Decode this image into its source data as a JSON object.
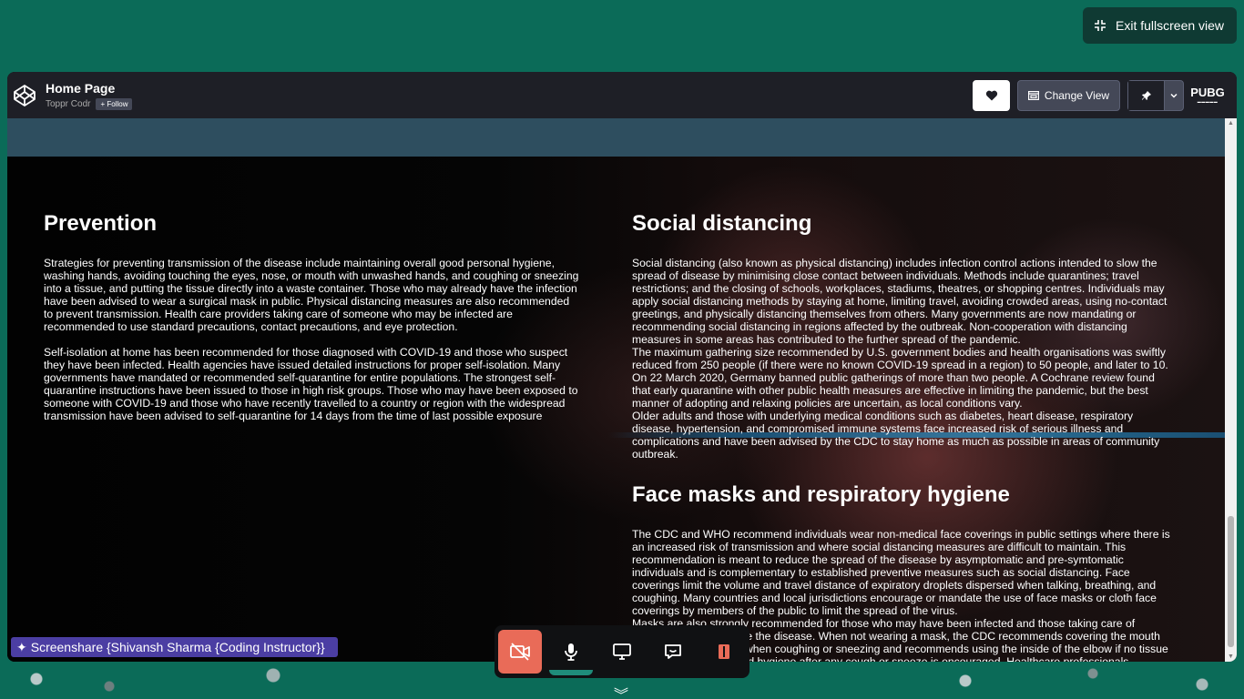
{
  "fullscreen": {
    "exit_label": "Exit fullscreen view"
  },
  "codepen": {
    "title": "Home Page",
    "author": "Toppr Codr",
    "follow_label": "+ Follow",
    "change_view_label": "Change View",
    "badge_logo_text": "PUBG"
  },
  "sections": {
    "prevention": {
      "heading": "Prevention",
      "p1": "Strategies for preventing transmission of the disease include maintaining overall good personal hygiene, washing hands, avoiding touching the eyes, nose, or mouth with unwashed hands, and coughing or sneezing into a tissue, and putting the tissue directly into a waste container. Those who may already have the infection have been advised to wear a surgical mask in public. Physical distancing measures are also recommended to prevent transmission. Health care providers taking care of someone who may be infected are recommended to use standard precautions, contact precautions, and eye protection.",
      "p2": "Self-isolation at home has been recommended for those diagnosed with COVID-19 and those who suspect they have been infected. Health agencies have issued detailed instructions for proper self-isolation. Many governments have mandated or recommended self-quarantine for entire populations. The strongest self-quarantine instructions have been issued to those in high risk groups. Those who may have been exposed to someone with COVID-19 and those who have recently travelled to a country or region with the widespread transmission have been advised to self-quarantine for 14 days from the time of last possible exposure"
    },
    "social": {
      "heading": "Social distancing",
      "p1": "Social distancing (also known as physical distancing) includes infection control actions intended to slow the spread of disease by minimising close contact between individuals. Methods include quarantines; travel restrictions; and the closing of schools, workplaces, stadiums, theatres, or shopping centres. Individuals may apply social distancing methods by staying at home, limiting travel, avoiding crowded areas, using no-contact greetings, and physically distancing themselves from others. Many governments are now mandating or recommending social distancing in regions affected by the outbreak. Non-cooperation with distancing measures in some areas has contributed to the further spread of the pandemic.",
      "p2": "The maximum gathering size recommended by U.S. government bodies and health organisations was swiftly reduced from 250 people (if there were no known COVID-19 spread in a region) to 50 people, and later to 10. On 22 March 2020, Germany banned public gatherings of more than two people. A Cochrane review found that early quarantine with other public health measures are effective in limiting the pandemic, but the best manner of adopting and relaxing policies are uncertain, as local conditions vary.",
      "p3": "Older adults and those with underlying medical conditions such as diabetes, heart disease, respiratory disease, hypertension, and compromised immune systems face increased risk of serious illness and complications and have been advised by the CDC to stay home as much as possible in areas of community outbreak."
    },
    "masks": {
      "heading": "Face masks and respiratory hygiene",
      "p1": "The CDC and WHO recommend individuals wear non-medical face coverings in public settings where there is an increased risk of transmission and where social distancing measures are difficult to maintain. This recommendation is meant to reduce the spread of the disease by asymptomatic and pre-symtomatic individuals and is complementary to established preventive measures such as social distancing. Face coverings limit the volume and travel distance of expiratory droplets dispersed when talking, breathing, and coughing. Many countries and local jurisdictions encourage or mandate the use of face masks or cloth face coverings by members of the public to limit the spread of the virus.",
      "p2": "Masks are also strongly recommended for those who may have been infected and those taking care of someone who may have the disease. When not wearing a mask, the CDC recommends covering the mouth and nose with a tissue when coughing or sneezing and recommends using the inside of the elbow if no tissue is available. Proper hand hygiene after any cough or sneeze is encouraged. Healthcare professionals interacting directly with COVID-19 patients are advised to use respirators at least as protective as NIOSH-certified N95 or equivalent, in addition to other personal protective equipment."
    }
  },
  "screenshare": {
    "label": "Screenshare {Shivansh Sharma {Coding Instructor}}"
  },
  "icons": [
    "exit-fullscreen-icon",
    "codepen-logo-icon",
    "heart-icon",
    "change-view-icon",
    "pin-icon",
    "chevron-down-icon",
    "camera-off-icon",
    "mic-icon",
    "screen-icon",
    "chat-icon",
    "leave-icon"
  ],
  "colors": {
    "background": "#0b6b58",
    "header": "#1e1f26",
    "camera_off": "#e96b58",
    "screenshare": "#4b3ea3"
  }
}
